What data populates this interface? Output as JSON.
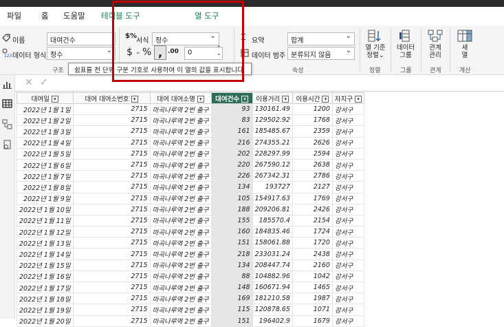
{
  "tabs": [
    "파일",
    "홈",
    "도움말",
    "테이블 도구",
    "열 도구"
  ],
  "ribbon": {
    "name_label": "이름",
    "name_value": "대여건수",
    "datatype_label": "데이터 형식",
    "datatype_value": "정수",
    "format_label": "서식",
    "format_value": "정수",
    "decimal_value": "0",
    "summary_label": "요약",
    "summary_value": "합계",
    "category_label": "데이터 범주",
    "category_value": "분류되지 않음",
    "group_structure": "구조",
    "group_properties": "속성",
    "btn_sort": "열 기준\n정렬",
    "btn_sort_caret": "⌄",
    "group_sort": "정렬",
    "btn_data_group": "데이터\n그룹",
    "group_group": "그룹",
    "btn_relations": "관계\n관리",
    "group_relations": "관계",
    "btn_new_column": "새\n열",
    "group_calc": "계산"
  },
  "tooltip": "쉼표를 천 단위 구분 기호로 사용하여 이 열의 값을 표시합니다",
  "table": {
    "columns": [
      "대여일",
      "대여 대여소번호",
      "대여 대여소명",
      "대여건수",
      "이용거리",
      "이용시간",
      "자치구"
    ],
    "rows": [
      [
        "2022년 1월 1일",
        "2715",
        "마곡나루역 2번 출구",
        "93",
        "130161.49",
        "1200",
        "강서구"
      ],
      [
        "2022년 1월 2일",
        "2715",
        "마곡나루역 2번 출구",
        "83",
        "129502.92",
        "1768",
        "강서구"
      ],
      [
        "2022년 1월 3일",
        "2715",
        "마곡나루역 2번 출구",
        "161",
        "185485.67",
        "2359",
        "강서구"
      ],
      [
        "2022년 1월 4일",
        "2715",
        "마곡나루역 2번 출구",
        "216",
        "274355.21",
        "2626",
        "강서구"
      ],
      [
        "2022년 1월 5일",
        "2715",
        "마곡나루역 2번 출구",
        "202",
        "228297.99",
        "2594",
        "강서구"
      ],
      [
        "2022년 1월 6일",
        "2715",
        "마곡나루역 2번 출구",
        "220",
        "267590.12",
        "2638",
        "강서구"
      ],
      [
        "2022년 1월 7일",
        "2715",
        "마곡나루역 2번 출구",
        "226",
        "267342.31",
        "2786",
        "강서구"
      ],
      [
        "2022년 1월 8일",
        "2715",
        "마곡나루역 2번 출구",
        "134",
        "193727",
        "2127",
        "강서구"
      ],
      [
        "2022년 1월 9일",
        "2715",
        "마곡나루역 2번 출구",
        "105",
        "154917.63",
        "1769",
        "강서구"
      ],
      [
        "2022년 1월 10일",
        "2715",
        "마곡나루역 2번 출구",
        "188",
        "209206.81",
        "2426",
        "강서구"
      ],
      [
        "2022년 1월 11일",
        "2715",
        "마곡나루역 2번 출구",
        "155",
        "185570.4",
        "2154",
        "강서구"
      ],
      [
        "2022년 1월 12일",
        "2715",
        "마곡나루역 2번 출구",
        "160",
        "184835.46",
        "1724",
        "강서구"
      ],
      [
        "2022년 1월 13일",
        "2715",
        "마곡나루역 2번 출구",
        "151",
        "158061.88",
        "1720",
        "강서구"
      ],
      [
        "2022년 1월 14일",
        "2715",
        "마곡나루역 2번 출구",
        "218",
        "233031.24",
        "2438",
        "강서구"
      ],
      [
        "2022년 1월 15일",
        "2715",
        "마곡나루역 2번 출구",
        "134",
        "208447.74",
        "2160",
        "강서구"
      ],
      [
        "2022년 1월 16일",
        "2715",
        "마곡나루역 2번 출구",
        "88",
        "104882.96",
        "1042",
        "강서구"
      ],
      [
        "2022년 1월 17일",
        "2715",
        "마곡나루역 2번 출구",
        "148",
        "160671.94",
        "1465",
        "강서구"
      ],
      [
        "2022년 1월 18일",
        "2715",
        "마곡나루역 2번 출구",
        "169",
        "181210.58",
        "1987",
        "강서구"
      ],
      [
        "2022년 1월 19일",
        "2715",
        "마곡나루역 2번 출구",
        "115",
        "120878.65",
        "1071",
        "강서구"
      ],
      [
        "2022년 1월 20일",
        "2715",
        "마곡나루역 2번 출구",
        "151",
        "196402.9",
        "1679",
        "강서구"
      ]
    ]
  },
  "colors": {
    "accent": "#1a7a4c",
    "selected_header": "#2d6e57",
    "highlight_box": "#c00000"
  }
}
